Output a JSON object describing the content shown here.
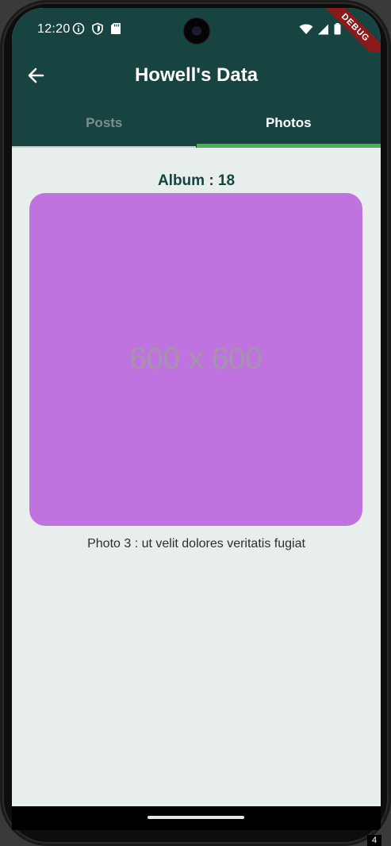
{
  "status_bar": {
    "time": "12:20",
    "left_icons": [
      "info-icon",
      "shield-icon",
      "sd-card-icon"
    ],
    "right_icons": [
      "wifi-icon",
      "cell-signal-icon",
      "battery-icon"
    ]
  },
  "debug_banner": "DEBUG",
  "app_bar": {
    "title": "Howell's Data",
    "back_icon": "arrow-back-icon"
  },
  "tabs": [
    {
      "label": "Posts",
      "active": false
    },
    {
      "label": "Photos",
      "active": true
    }
  ],
  "content": {
    "album_title": "Album : 18",
    "photo_placeholder_text": "600 x 600",
    "photo_color": "#bf73df",
    "caption": "Photo 3 : ut velit dolores veritatis fugiat"
  },
  "colors": {
    "app_bar": "#174440",
    "tab_indicator": "#4caf50",
    "background": "#e8eeec"
  },
  "corner_badge": "4"
}
